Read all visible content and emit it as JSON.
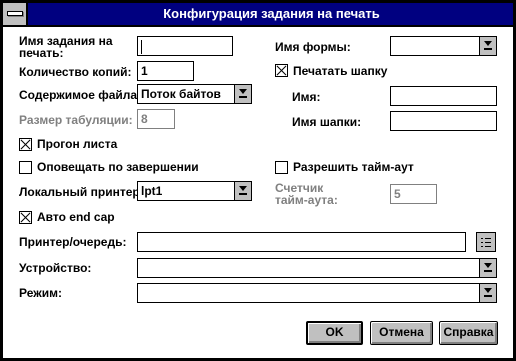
{
  "window": {
    "title": "Конфигурация задания на печать"
  },
  "job_name": {
    "label_line1": "Имя задания на",
    "label_line2": "печать:",
    "value": ""
  },
  "copies": {
    "label": "Количество копий:",
    "value": "1"
  },
  "file_content": {
    "label": "Содержимое файла:",
    "value": "Поток байтов"
  },
  "tab_size": {
    "label": "Размер табуляции:",
    "value": "8"
  },
  "form_feed": {
    "label": "Прогон листа",
    "checked": true
  },
  "notify": {
    "label": "Оповещать по завершении",
    "checked": false
  },
  "local_printer": {
    "label": "Локальный принтер:",
    "value": "lpt1"
  },
  "auto_endcap": {
    "label": "Авто end cap",
    "checked": true
  },
  "form_name": {
    "label": "Имя формы:",
    "value": ""
  },
  "print_banner": {
    "label": "Печатать шапку",
    "checked": true
  },
  "banner_name": {
    "label": "Имя:",
    "value": ""
  },
  "banner_title": {
    "label": "Имя шапки:",
    "value": ""
  },
  "allow_timeout": {
    "label": "Разрешить тайм-аут",
    "checked": false
  },
  "timeout_counter": {
    "label_line1": "Счетчик",
    "label_line2": "тайм-аута:",
    "value": "5"
  },
  "printer_queue": {
    "label": "Принтер/очередь:",
    "value": ""
  },
  "device": {
    "label": "Устройство:",
    "value": ""
  },
  "mode": {
    "label": "Режим:",
    "value": ""
  },
  "buttons": {
    "ok": "OK",
    "cancel": "Отмена",
    "help": "Справка"
  },
  "colors": {
    "titlebar": "#000080",
    "button_face": "#c0c0c0",
    "disabled_text": "#808080"
  }
}
